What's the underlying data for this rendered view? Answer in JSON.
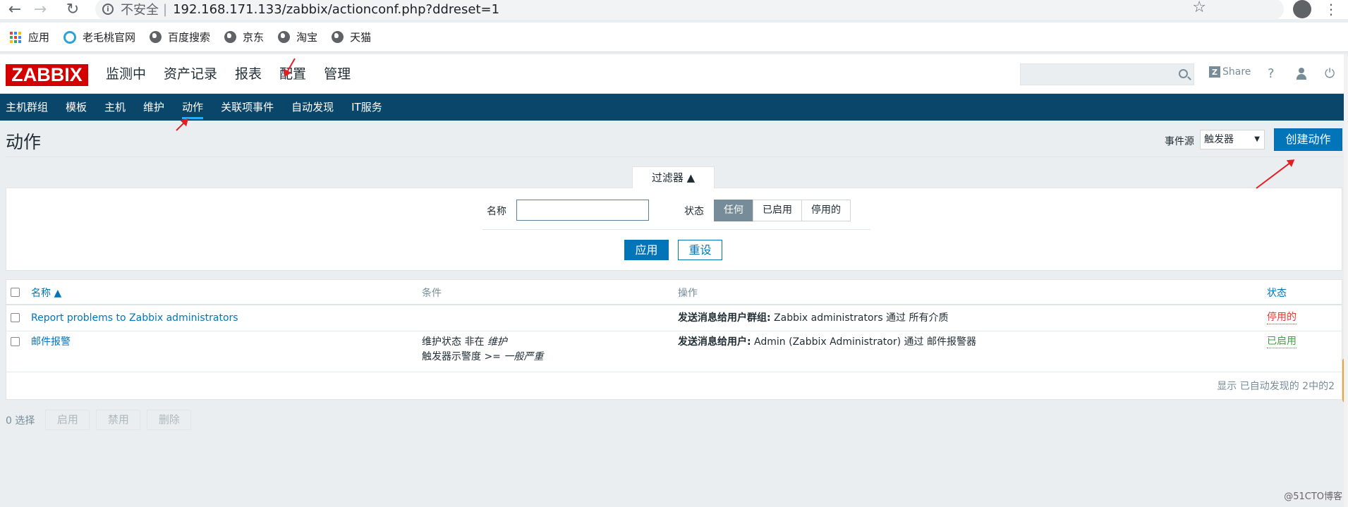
{
  "browser": {
    "security_label": "不安全",
    "url_separator": "|",
    "url": "192.168.171.133/zabbix/actionconf.php?ddreset=1",
    "bookmarks": [
      "应用",
      "老毛桃官网",
      "百度搜索",
      "京东",
      "淘宝",
      "天猫"
    ]
  },
  "header": {
    "logo": "ZABBIX",
    "menu": [
      "监测中",
      "资产记录",
      "报表",
      "配置",
      "管理"
    ],
    "share_label": "Share",
    "help_label": "?",
    "power_label": "⏻"
  },
  "submenu": [
    "主机群组",
    "模板",
    "主机",
    "维护",
    "动作",
    "关联项事件",
    "自动发现",
    "IT服务"
  ],
  "page": {
    "title": "动作",
    "event_source_label": "事件源",
    "event_source_value": "触发器",
    "create_button": "创建动作"
  },
  "filter": {
    "tab_label": "过滤器 ▲",
    "name_label": "名称",
    "name_value": "",
    "status_label": "状态",
    "status_options": [
      "任何",
      "已启用",
      "停用的"
    ],
    "status_selected": "任何",
    "apply_button": "应用",
    "reset_button": "重设"
  },
  "table": {
    "columns": [
      "名称 ▲",
      "条件",
      "操作",
      "状态"
    ],
    "rows": [
      {
        "name": "Report problems to Zabbix administrators",
        "conditions": [],
        "operation_bold": "发送消息给用户群组:",
        "operation_rest": " Zabbix administrators 通过 所有介质",
        "status": "停用的"
      },
      {
        "name": "邮件报警",
        "conditions": [
          {
            "prefix": "维护状态 非在 ",
            "value": "维护"
          },
          {
            "prefix": "触发器示警度 >= ",
            "value": "一般严重"
          }
        ],
        "operation_bold": "发送消息给用户:",
        "operation_rest": " Admin (Zabbix Administrator) 通过 邮件报警器",
        "status": "已启用"
      }
    ],
    "footer": "显示 已自动发现的 2中的2"
  },
  "bottom": {
    "selected_count": "0 选择",
    "buttons": [
      "启用",
      "禁用",
      "删除"
    ]
  },
  "watermark": "@51CTO博客",
  "colors": {
    "brand_red": "#d40000",
    "nav_blue": "#0a466a",
    "primary_button": "#0275b8",
    "status_disabled": "#e33734",
    "status_enabled": "#429e47",
    "annotation_arrow": "#e31e24"
  }
}
